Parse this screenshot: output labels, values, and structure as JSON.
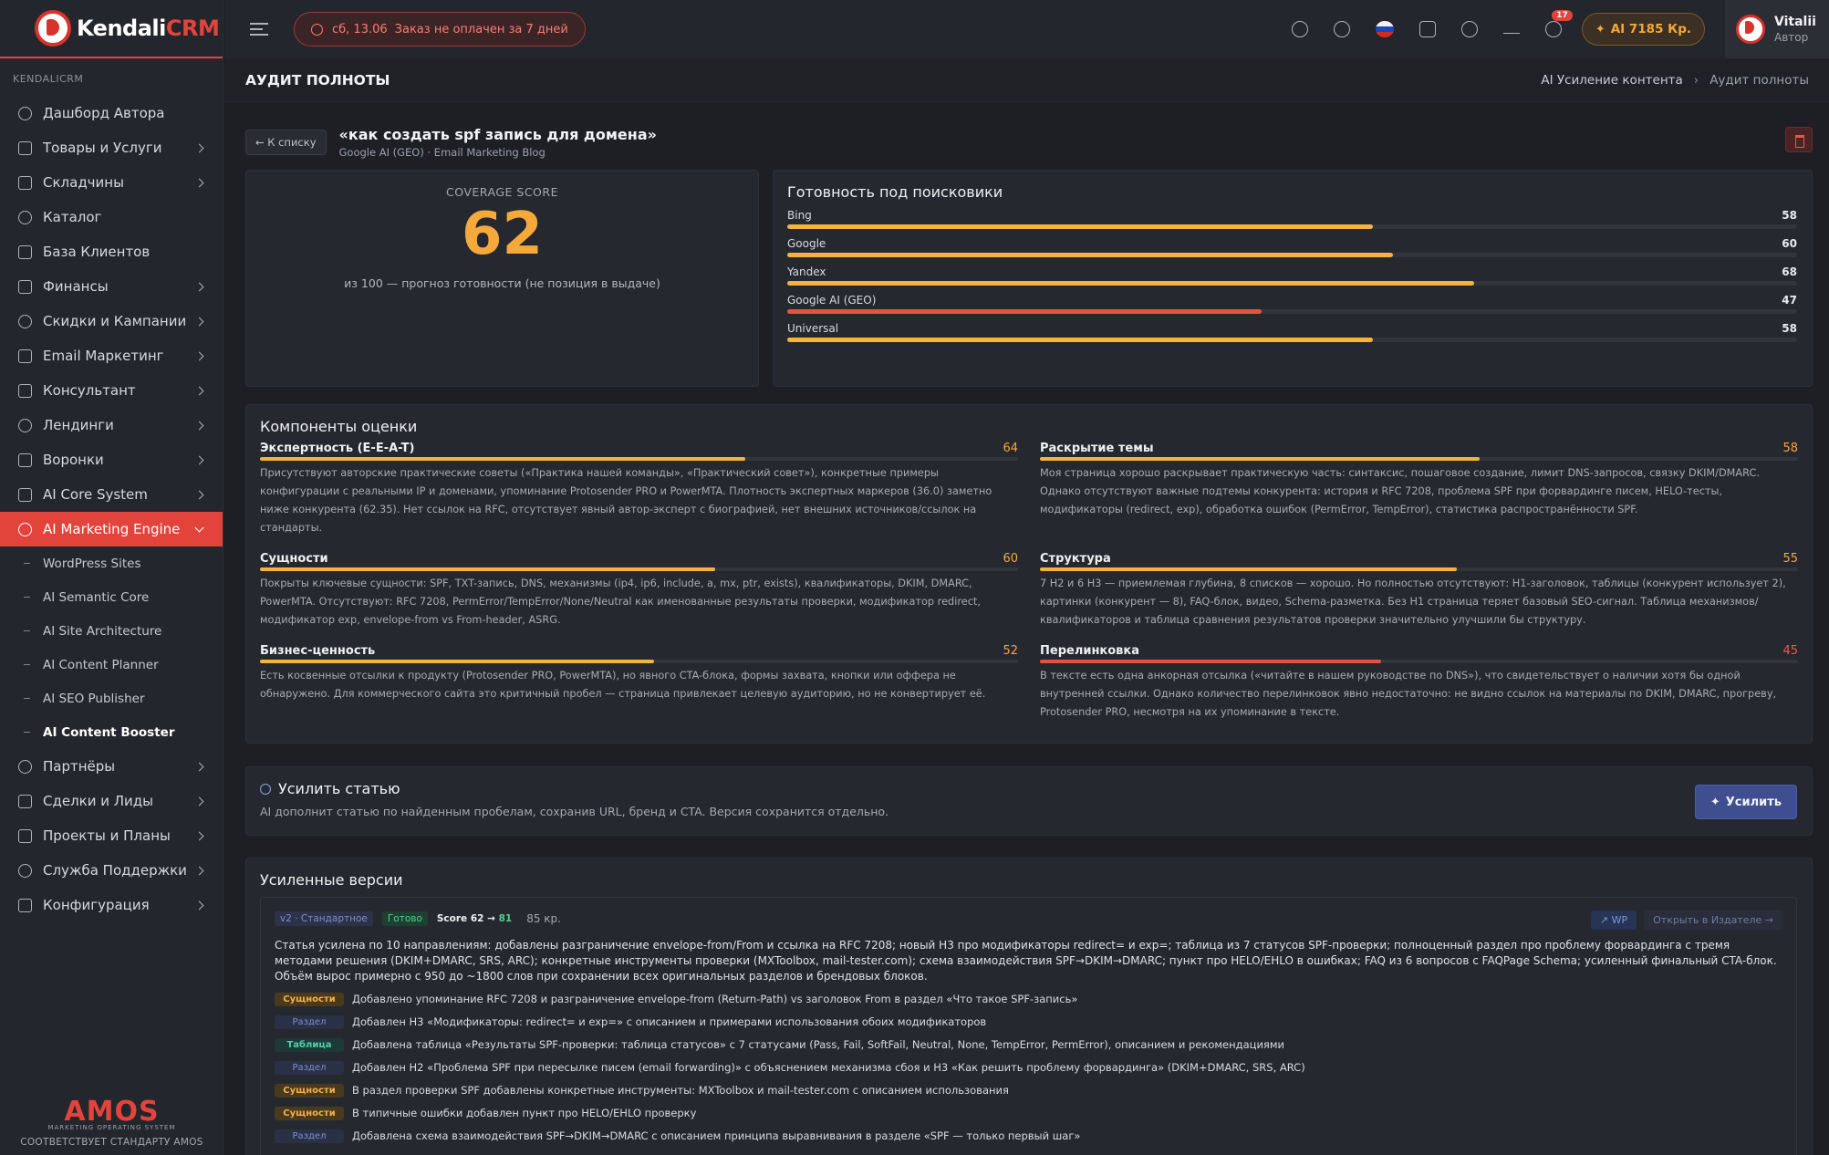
{
  "brand": {
    "name_main": "Kendali",
    "name_accent": "CRM"
  },
  "sidebar": {
    "section": "KENDALICRM",
    "items": [
      {
        "label": "Дашборд Автора",
        "chevron": false
      },
      {
        "label": "Товары и Услуги",
        "chevron": true
      },
      {
        "label": "Складчины",
        "chevron": true
      },
      {
        "label": "Каталог",
        "chevron": false
      },
      {
        "label": "База Клиентов",
        "chevron": false
      },
      {
        "label": "Финансы",
        "chevron": true
      },
      {
        "label": "Скидки и Кампании",
        "chevron": true
      },
      {
        "label": "Email Маркетинг",
        "chevron": true
      },
      {
        "label": "Консультант",
        "chevron": true
      },
      {
        "label": "Лендинги",
        "chevron": true
      },
      {
        "label": "Воронки",
        "chevron": true
      },
      {
        "label": "AI Core System",
        "chevron": true
      },
      {
        "label": "AI Marketing Engine",
        "chevron": true,
        "active": true
      }
    ],
    "subitems": [
      "WordPress Sites",
      "AI Semantic Core",
      "AI Site Architecture",
      "AI Content Planner",
      "AI SEO Publisher",
      "AI Content Booster"
    ],
    "items_after": [
      {
        "label": "Партнёры"
      },
      {
        "label": "Сделки и Лиды"
      },
      {
        "label": "Проекты и Планы"
      },
      {
        "label": "Служба Поддержки"
      },
      {
        "label": "Конфигурация"
      }
    ],
    "amos_logo": "AMOS",
    "amos_tagline": "MARKETING OPERATING SYSTEM",
    "amos_standard": "СООТВЕТСТВУЕТ СТАНДАРТУ AMOS"
  },
  "topbar": {
    "alert_date": "сб, 13.06",
    "alert_text": "Заказ не оплачен за 7 дней",
    "notifications": "17",
    "ai_credits": "AI 7185 Кр.",
    "user_name": "Vitalii",
    "user_role": "Автор"
  },
  "page": {
    "title": "АУДИТ ПОЛНОТЫ",
    "breadcrumb_parent": "AI Усиление контента",
    "breadcrumb_current": "Аудит полноты"
  },
  "article": {
    "back_label": "← К списку",
    "title": "«как создать spf запись для домена»",
    "subtitle": "Google AI (GEO) · Email Marketing Blog"
  },
  "coverage": {
    "label": "COVERAGE SCORE",
    "score": "62",
    "note": "из 100 — прогноз готовности (не позиция в выдаче)"
  },
  "readiness": {
    "title": "Готовность под поисковики",
    "engines": [
      {
        "name": "Bing",
        "value": 58,
        "color": "#f3b43c"
      },
      {
        "name": "Google",
        "value": 60,
        "color": "#f3b43c"
      },
      {
        "name": "Yandex",
        "value": 68,
        "color": "#f3b43c"
      },
      {
        "name": "Google AI (GEO)",
        "value": 47,
        "color": "#e5533c"
      },
      {
        "name": "Universal",
        "value": 58,
        "color": "#f3b43c"
      }
    ]
  },
  "components": {
    "title": "Компоненты оценки",
    "items": [
      {
        "name": "Экспертность (E-E-A-T)",
        "score": 64,
        "color": "#f3b43c",
        "text": "Присутствуют авторские практические советы («Практика нашей команды», «Практический совет»), конкретные примеры конфигурации с реальными IP и доменами, упоминание Protosender PRO и PowerMTA. Плотность экспертных маркеров (36.0) заметно ниже конкурента (62.35). Нет ссылок на RFC, отсутствует явный автор-эксперт с биографией, нет внешних источников/ссылок на стандарты."
      },
      {
        "name": "Раскрытие темы",
        "score": 58,
        "color": "#f3b43c",
        "text": "Моя страница хорошо раскрывает практическую часть: синтаксис, пошаговое создание, лимит DNS-запросов, связку DKIM/DMARC. Однако отсутствуют важные подтемы конкурента: история и RFC 7208, проблема SPF при форвардинге писем, HELO-тесты, модификаторы (redirect, exp), обработка ошибок (PermError, TempError), статистика распространённости SPF."
      },
      {
        "name": "Сущности",
        "score": 60,
        "color": "#f3b43c",
        "text": "Покрыты ключевые сущности: SPF, TXT-запись, DNS, механизмы (ip4, ip6, include, a, mx, ptr, exists), квалификаторы, DKIM, DMARC, PowerMTA. Отсутствуют: RFC 7208, PermError/TempError/None/Neutral как именованные результаты проверки, модификатор redirect, модификатор exp, envelope-from vs From-header, ASRG."
      },
      {
        "name": "Структура",
        "score": 55,
        "color": "#f3b43c",
        "text": "7 H2 и 6 H3 — приемлемая глубина, 8 списков — хорошо. Но полностью отсутствуют: H1-заголовок, таблицы (конкурент использует 2), картинки (конкурент — 8), FAQ-блок, видео, Schema-разметка. Без H1 страница теряет базовый SEO-сигнал. Таблица механизмов/квалификаторов и таблица сравнения результатов проверки значительно улучшили бы структуру."
      },
      {
        "name": "Бизнес-ценность",
        "score": 52,
        "color": "#f3b43c",
        "text": "Есть косвенные отсылки к продукту (Protosender PRO, PowerMTA), но явного CTA-блока, формы захвата, кнопки или оффера не обнаружено. Для коммерческого сайта это критичный пробел — страница привлекает целевую аудиторию, но не конвертирует её."
      },
      {
        "name": "Перелинковка",
        "score": 45,
        "color": "#e5533c",
        "red": true,
        "text": "В тексте есть одна анкорная отсылка («читайте в нашем руководстве по DNS»), что свидетельствует о наличии хотя бы одной внутренней ссылки. Однако количество перелинковок явно недостаточно: не видно ссылок на материалы по DKIM, DMARC, прогреву, Protosender PRO, несмотря на их упоминание в тексте."
      }
    ]
  },
  "boost": {
    "title": "Усилить статью",
    "desc": "AI дополнит статью по найденным пробелам, сохранив URL, бренд и CTA. Версия сохранится отдельно.",
    "button": "Усилить"
  },
  "versions": {
    "title": "Усиленные версии",
    "version_tag": "v2 · Стандартное",
    "status": "Готово",
    "score_prefix": "Score 62 →",
    "score_to": "81",
    "price": "85 кр.",
    "wp_label": "WP",
    "editor_label": "Открыть в Издателе →",
    "summary": "Статья усилена по 10 направлениям: добавлены разграничение envelope-from/From и ссылка на RFC 7208; новый H3 про модификаторы redirect= и exp=; таблица из 7 статусов SPF-проверки; полноценный раздел про проблему форвардинга с тремя методами решения (DKIM+DMARC, SRS, ARC); конкретные инструменты проверки (MXToolbox, mail-tester.com); схема взаимодействия SPF→DKIM→DMARC; пункт про HELO/EHLO в ошибках; FAQ из 6 вопросов с FAQPage Schema; усиленный финальный CTA-блок. Объём вырос примерно с 950 до ~1800 слов при сохранении всех оригинальных разделов и брендовых блоков.",
    "changes": [
      {
        "tag": "Сущности",
        "kind": "ent",
        "text": "Добавлено упоминание RFC 7208 и разграничение envelope-from (Return-Path) vs заголовок From в раздел «Что такое SPF-запись»"
      },
      {
        "tag": "Раздел",
        "kind": "sec",
        "text": "Добавлен H3 «Модификаторы: redirect= и exp=» с описанием и примерами использования обоих модификаторов"
      },
      {
        "tag": "Таблица",
        "kind": "tbl",
        "text": "Добавлена таблица «Результаты SPF-проверки: таблица статусов» с 7 статусами (Pass, Fail, SoftFail, Neutral, None, TempError, PermError), описанием и рекомендациями"
      },
      {
        "tag": "Раздел",
        "kind": "sec",
        "text": "Добавлен H2 «Проблема SPF при пересылке писем (email forwarding)» с объяснением механизма сбоя и H3 «Как решить проблему форвардинга» (DKIM+DMARC, SRS, ARC)"
      },
      {
        "tag": "Сущности",
        "kind": "ent",
        "text": "В раздел проверки SPF добавлены конкретные инструменты: MXToolbox и mail-tester.com с описанием использования"
      },
      {
        "tag": "Сущности",
        "kind": "ent",
        "text": "В типичные ошибки добавлен пункт про HELO/EHLO проверку"
      },
      {
        "tag": "Раздел",
        "kind": "sec",
        "text": "Добавлена схема взаимодействия SPF→DKIM→DMARC с описанием принципа выравнивания в разделе «SPF — только первый шаг»"
      }
    ]
  }
}
